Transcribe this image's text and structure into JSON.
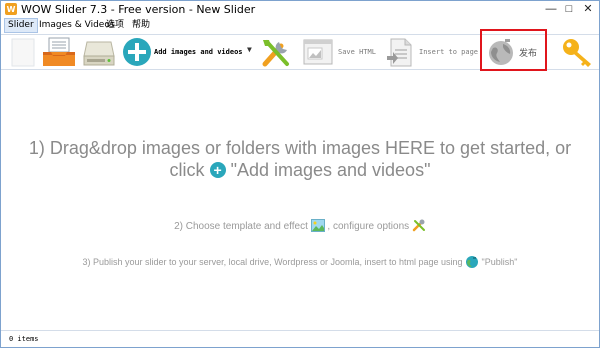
{
  "window": {
    "title": "WOW Slider 7.3 - Free version - New Slider"
  },
  "menu": [
    {
      "label": "Slider"
    },
    {
      "label": "Images & Videos"
    },
    {
      "label": "选项"
    },
    {
      "label": "帮助"
    }
  ],
  "toolbar": {
    "add_label": "Add images and videos",
    "save_html_label": "Save HTML",
    "insert_label": "Insert to page",
    "publish_label": "发布"
  },
  "main": {
    "line1a": "1) Drag&drop images or folders with images HERE to get started, or",
    "line1b_pre": "click",
    "line1b_post": "\"Add images and videos\"",
    "line2_pre": "2) Choose template and effect",
    "line2_post": ", configure options",
    "line3_pre": "3) Publish your slider to your server, local drive, Wordpress or Joomla, insert to html page using",
    "line3_post": "\"Publish\""
  },
  "status": {
    "items": "0 items"
  },
  "colors": {
    "accent_teal": "#2aa7bb",
    "highlight_red": "#e0151c",
    "hint_gray": "#8a8a8a"
  }
}
